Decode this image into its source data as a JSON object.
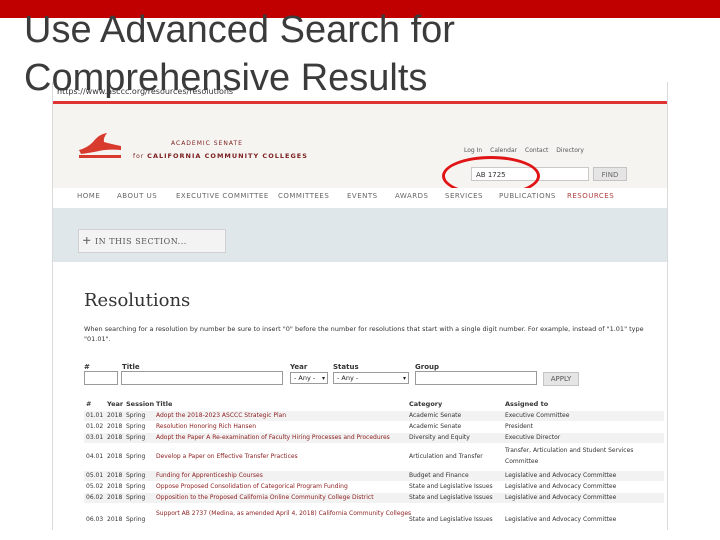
{
  "slide": {
    "title": "Use Advanced Search for\nComprehensive Results"
  },
  "browser": {
    "url": "https://www.asccc.org/resources/resolutions"
  },
  "site": {
    "org_line1": "ACADEMIC SENATE",
    "org_line2_prefix": "for",
    "org_line2": "CALIFORNIA COMMUNITY COLLEGES",
    "top_links": [
      "Log In",
      "Calendar",
      "Contact",
      "Directory"
    ],
    "search_value": "AB 1725",
    "find_label": "FIND",
    "nav": [
      "HOME",
      "ABOUT US",
      "EXECUTIVE COMMITTEE",
      "COMMITTEES",
      "EVENTS",
      "AWARDS",
      "SERVICES",
      "PUBLICATIONS",
      "RESOURCES"
    ]
  },
  "section": {
    "label": "IN THIS SECTION..."
  },
  "page": {
    "title": "Resolutions",
    "note": "When searching for a resolution by number be sure to insert \"0\" before the number for resolutions that start with a single digit number. For example, instead of \"1.01\" type \"01.01\"."
  },
  "filters": {
    "num_label": "#",
    "title_label": "Title",
    "year_label": "Year",
    "year_value": "- Any -",
    "status_label": "Status",
    "status_value": "- Any -",
    "group_label": "Group",
    "apply_label": "APPLY"
  },
  "table": {
    "headers": {
      "num": "#",
      "year": "Year",
      "session": "Session",
      "title": "Title",
      "category": "Category",
      "assigned": "Assigned to"
    },
    "rows": [
      {
        "num": "01.01",
        "year": "2018",
        "session": "Spring",
        "title": "Adopt the 2018-2023 ASCCC Strategic Plan",
        "category": "Academic Senate",
        "assigned": "Executive Committee",
        "assigned2": ""
      },
      {
        "num": "01.02",
        "year": "2018",
        "session": "Spring",
        "title": "Resolution Honoring Rich Hansen",
        "category": "Academic Senate",
        "assigned": "President",
        "assigned2": ""
      },
      {
        "num": "03.01",
        "year": "2018",
        "session": "Spring",
        "title": "Adopt the Paper A Re-examination of Faculty Hiring Processes and Procedures",
        "category": "Diversity and Equity",
        "assigned": "Executive Director",
        "assigned2": ""
      },
      {
        "num": "04.01",
        "year": "2018",
        "session": "Spring",
        "title": "Develop a Paper on Effective Transfer Practices",
        "category": "Articulation and Transfer",
        "assigned": "Transfer, Articulation and Student Services",
        "assigned2": "Committee"
      },
      {
        "num": "05.01",
        "year": "2018",
        "session": "Spring",
        "title": "Funding for Apprenticeship Courses",
        "category": "Budget and Finance",
        "assigned": "Legislative and Advocacy Committee",
        "assigned2": ""
      },
      {
        "num": "05.02",
        "year": "2018",
        "session": "Spring",
        "title": "Oppose Proposed Consolidation of Categorical Program Funding",
        "category": "State and Legislative Issues",
        "assigned": "Legislative and Advocacy Committee",
        "assigned2": ""
      },
      {
        "num": "06.02",
        "year": "2018",
        "session": "Spring",
        "title": "Opposition to the Proposed California Online Community College District",
        "category": "State and Legislative Issues",
        "assigned": "Legislative and Advocacy Committee",
        "assigned2": ""
      },
      {
        "num": "06.03",
        "year": "2018",
        "session": "Spring",
        "title": "Support AB 2737 (Medina, as amended April 4, 2018) California Community Colleges",
        "category": "State and Legislative Issues",
        "assigned": "Legislative and Advocacy Committee",
        "assigned2": ""
      }
    ]
  },
  "colors": {
    "slide_bar": "#c00000",
    "brand_red": "#e03434",
    "annotation_circle": "#e01414"
  }
}
